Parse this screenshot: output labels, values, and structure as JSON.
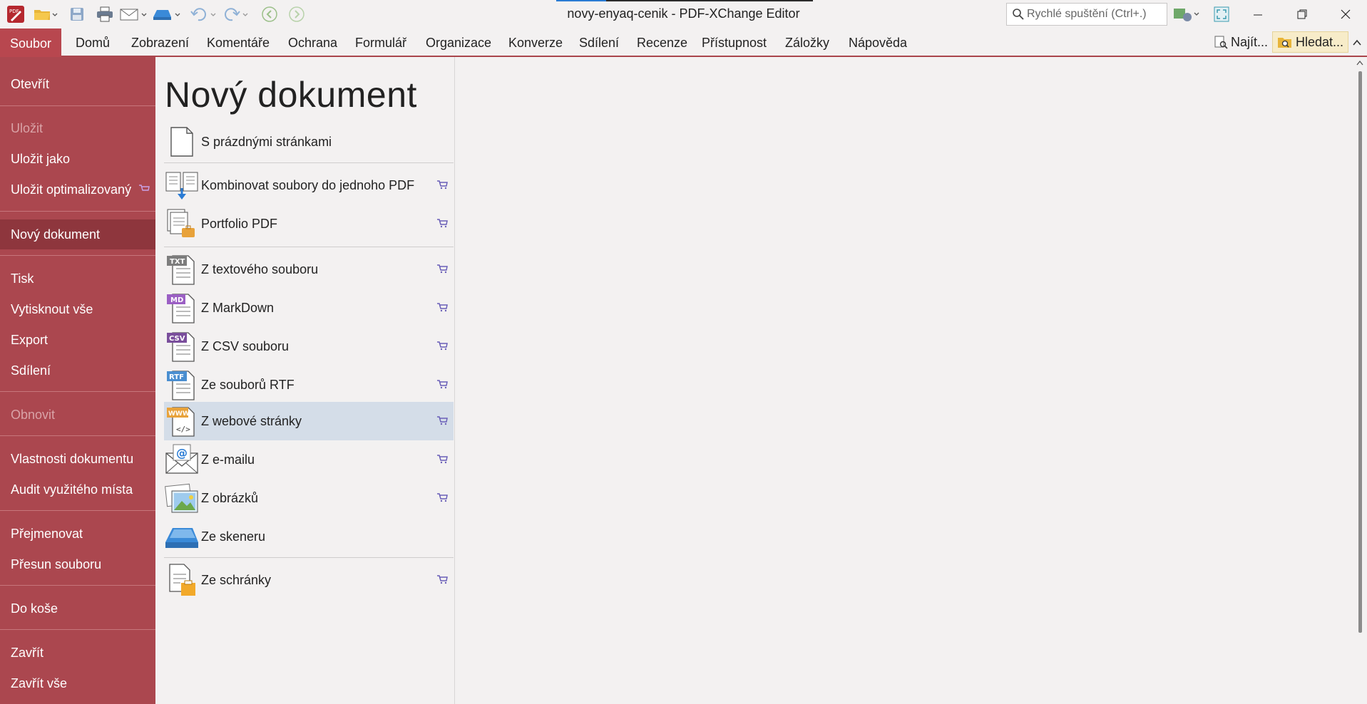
{
  "window": {
    "title": "novy-enyaq-cenik - PDF-XChange Editor",
    "quick_launch_placeholder": "Rychlé spuštění (Ctrl+.)"
  },
  "menubar": {
    "items": [
      "Soubor",
      "Domů",
      "Zobrazení",
      "Komentáře",
      "Ochrana",
      "Formulář",
      "Organizace",
      "Konverze",
      "Sdílení",
      "Recenze",
      "Přístupnost",
      "Záložky",
      "Nápověda"
    ],
    "find_label": "Najít...",
    "search_label": "Hledat..."
  },
  "file_menu": {
    "open": "Otevřít",
    "save": "Uložit",
    "save_as": "Uložit jako",
    "save_optimized": "Uložit optimalizovaný",
    "new_document": "Nový dokument",
    "print": "Tisk",
    "print_all": "Vytisknout vše",
    "export": "Export",
    "share": "Sdílení",
    "revert": "Obnovit",
    "doc_properties": "Vlastnosti dokumentu",
    "space_audit": "Audit využitého místa",
    "rename": "Přejmenovat",
    "move_file": "Přesun souboru",
    "trash": "Do koše",
    "close": "Zavřít",
    "close_all": "Zavřít vše"
  },
  "new_document": {
    "title": "Nový dokument",
    "options": [
      {
        "label": "S prázdnými stránkami",
        "icon": "blank-page-icon"
      },
      {
        "label": "Kombinovat soubory do jednoho PDF",
        "icon": "combine-files-icon"
      },
      {
        "label": "Portfolio PDF",
        "icon": "portfolio-icon"
      },
      {
        "label": "Z textového souboru",
        "icon": "txt-file-icon",
        "badge": "TXT"
      },
      {
        "label": "Z MarkDown",
        "icon": "markdown-file-icon",
        "badge": "MD"
      },
      {
        "label": "Z CSV souboru",
        "icon": "csv-file-icon",
        "badge": "CSV"
      },
      {
        "label": "Ze souborů RTF",
        "icon": "rtf-file-icon",
        "badge": "RTF"
      },
      {
        "label": "Z webové stránky",
        "icon": "web-page-icon",
        "badge": "WWW"
      },
      {
        "label": "Z e-mailu",
        "icon": "email-icon"
      },
      {
        "label": "Z obrázků",
        "icon": "image-icon"
      },
      {
        "label": "Ze skeneru",
        "icon": "scanner-icon"
      },
      {
        "label": "Ze schránky",
        "icon": "clipboard-icon"
      }
    ]
  },
  "colors": {
    "accent": "#ab474f",
    "accent_dark": "#8e363d",
    "hover": "#d4dde8",
    "cart": "#6a5fb8"
  }
}
